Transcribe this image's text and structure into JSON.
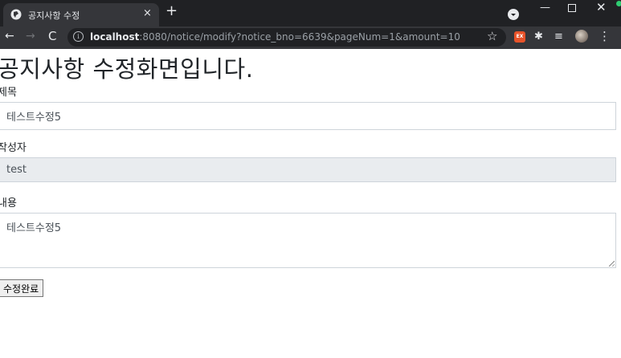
{
  "browser": {
    "tab_title": "공지사항 수정",
    "tab_close": "×",
    "new_tab": "+",
    "url_host": "localhost",
    "url_rest": ":8080/notice/modify?notice_bno=6639&pageNum=1&amount=10",
    "icons": {
      "favicon": "globe-icon",
      "back": "←",
      "forward": "→",
      "reload": "C",
      "info": "i",
      "star": "☆",
      "puzzle": "✱",
      "media": "≡",
      "menu": "⋮",
      "minimize": "—",
      "close": "✕"
    },
    "extension_label": "EX",
    "colors": {
      "tabstrip": "#202124",
      "toolbar": "#35363a",
      "ext_accent": "#e8532a"
    }
  },
  "page": {
    "heading": "공지사항 수정화면입니다.",
    "title_label": "제목",
    "title_value": "테스트수정5",
    "writer_label": "작성자",
    "writer_value": "test",
    "content_label": "내용",
    "content_value": "테스트수정5",
    "submit_label": "수정완료"
  }
}
